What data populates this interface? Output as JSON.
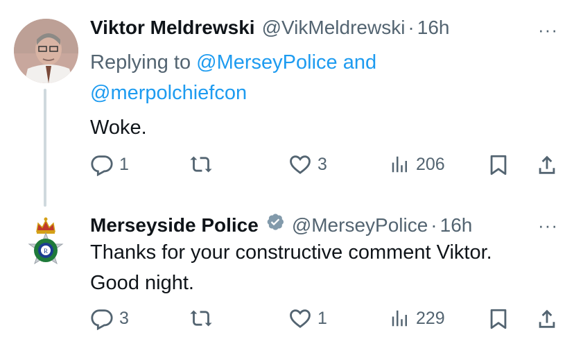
{
  "tweets": [
    {
      "name": "Viktor Meldrewski",
      "handle": "@VikMeldrewski",
      "separator": "·",
      "time": "16h",
      "more": "···",
      "replying_prefix": "Replying to ",
      "replying_mention1": "@MerseyPolice",
      "replying_and": " and",
      "replying_mention2": "@merpolchiefcon",
      "text": "Woke.",
      "actions": {
        "reply": "1",
        "retweet": "",
        "like": "3",
        "views": "206"
      }
    },
    {
      "name": "Merseyside Police",
      "handle": "@MerseyPolice",
      "separator": "·",
      "time": "16h",
      "more": "···",
      "text_line1": "Thanks for your constructive comment Viktor.",
      "text_line2": "Good night.",
      "actions": {
        "reply": "3",
        "retweet": "",
        "like": "1",
        "views": "229"
      }
    }
  ],
  "colors": {
    "link": "#1d9bf0",
    "muted": "#536471",
    "text": "#0f1419",
    "thread_line": "#cfd9de"
  },
  "icons": [
    "reply-icon",
    "retweet-icon",
    "like-icon",
    "views-icon",
    "bookmark-icon",
    "share-icon",
    "verified-badge-icon",
    "more-icon"
  ]
}
